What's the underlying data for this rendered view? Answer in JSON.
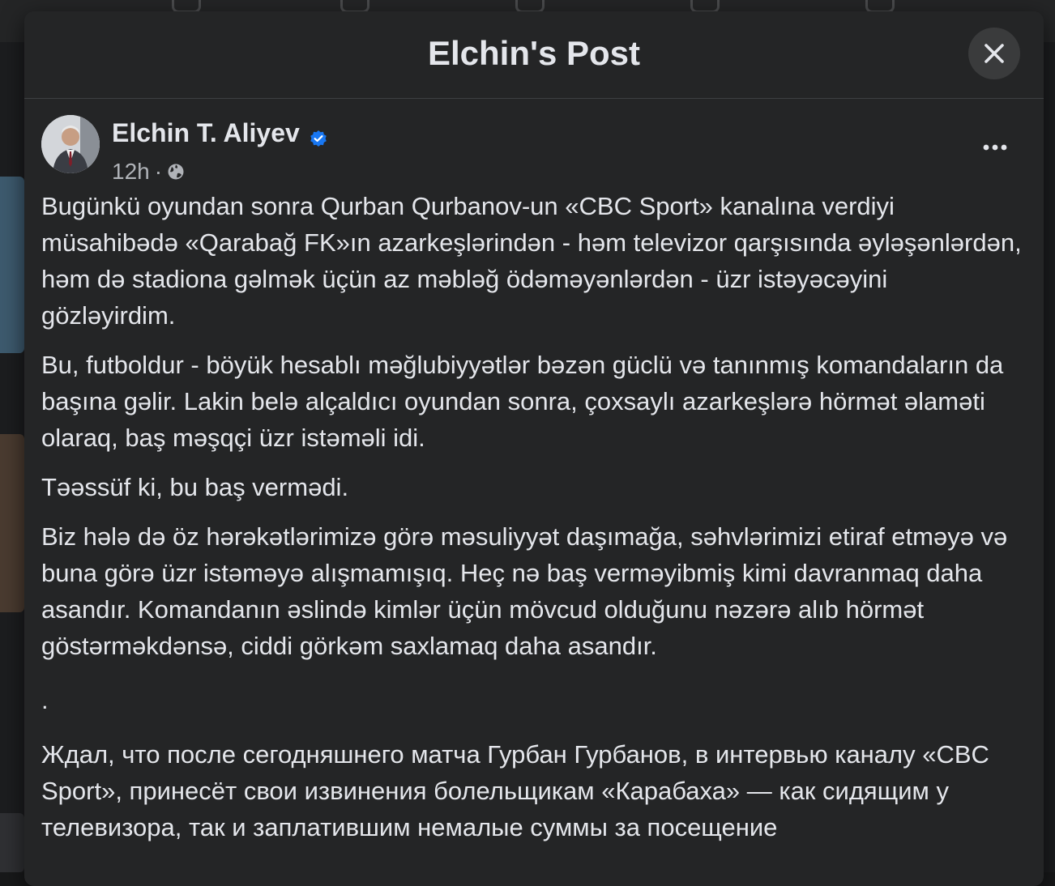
{
  "dialog": {
    "title": "Elchin's Post",
    "close_icon": "close-icon"
  },
  "post": {
    "author": "Elchin T. Aliyev",
    "verified_icon": "verified-badge-icon",
    "time": "12h",
    "separator": "·",
    "audience_icon": "globe-icon",
    "more_icon": "more-options-icon",
    "paragraphs": [
      "Bugünkü oyundan sonra Qurban Qurbanov-un «CBC Sport» kanalına verdiyi müsahibədə «Qarabağ FK»ın azarkeşlərindən - həm televizor qarşısında əyləşənlərdən, həm də stadiona gəlmək üçün az məbləğ ödəməyənlərdən - üzr istəyəcəyini gözləyirdim.",
      "Bu, futboldur - böyük hesablı məğlubiyyətlər bəzən güclü və tanınmış komandaların da başına gəlir. Lakin belə alçaldıcı oyundan sonra, çoxsaylı azarkeşlərə hörmət əlaməti olaraq, baş məşqçi üzr istəməli idi.",
      "Təəssüf ki, bu baş vermədi.",
      "Biz hələ də öz hərəkətlərimizə görə məsuliyyət daşımağa, səhvlərimizi etiraf etməyə və buna görə üzr istəməyə alışmamışıq. Heç nə baş verməyibmiş kimi davranmaq daha asandır. Komandanın əslində kimlər üçün mövcud olduğunu nəzərə alıb hörmət göstərməkdənsə, ciddi görkəm saxlamaq daha asandır.",
      ".",
      "Ждал, что после сегодняшнего матча Гурбан Гурбанов, в интервью каналу «CBC Sport», принесёт свои извинения болельщикам «Карабаха» — как сидящим у телевизора, так и заплатившим немалые суммы за посещение"
    ]
  },
  "colors": {
    "background": "#18191a",
    "dialog": "#242526",
    "text_primary": "#e4e6eb",
    "text_secondary": "#b0b3b8",
    "verified_blue": "#1877f2"
  }
}
